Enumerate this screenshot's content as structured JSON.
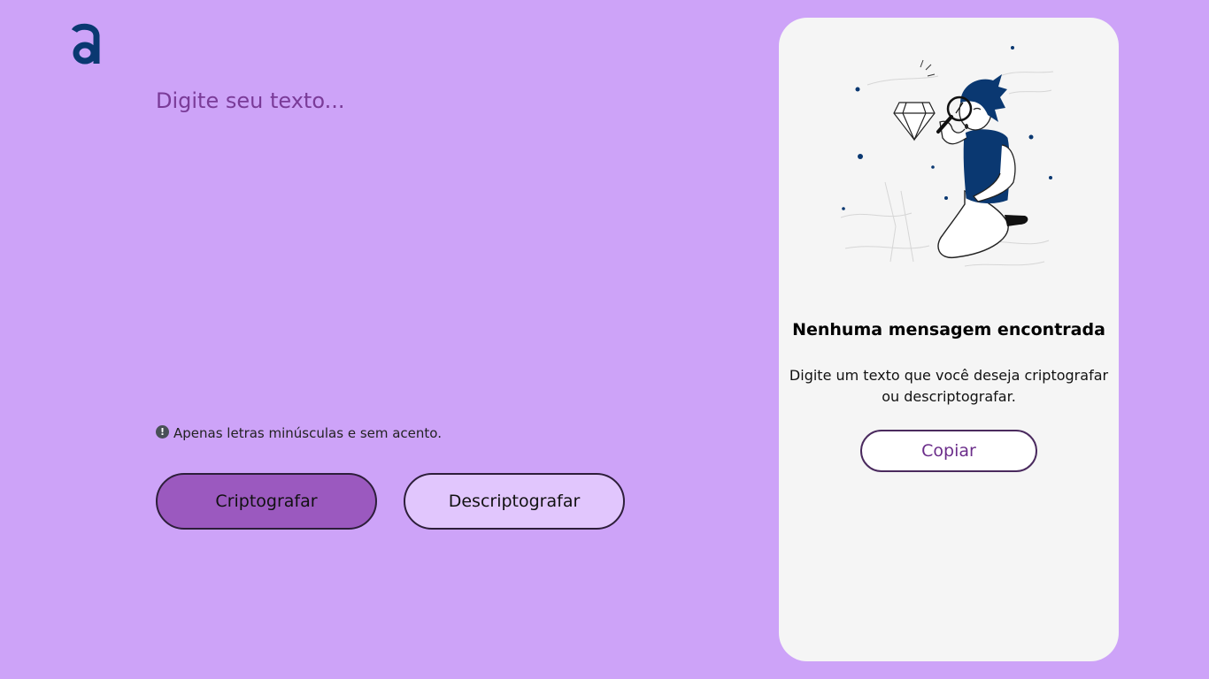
{
  "logo": {
    "icon": "alura-a-logo-icon",
    "color": "#0a3871"
  },
  "input": {
    "placeholder": "Digite seu texto..."
  },
  "hint": {
    "icon": "exclamation-circle-icon",
    "text": "Apenas letras minúsculas e sem acento."
  },
  "buttons": {
    "encrypt": "Criptografar",
    "decrypt": "Descriptografar"
  },
  "output": {
    "illustration": "person-magnifying-glass-diamond-illustration",
    "title": "Nenhuma mensagem encontrada",
    "description": "Digite um texto que você deseja criptografar ou descriptografar.",
    "copy_label": "Copiar"
  },
  "colors": {
    "background": "#cda3f8",
    "panel": "#f5f5f5",
    "encrypt_button": "#9b59bf",
    "decrypt_button": "#e1c6fd",
    "accent": "#0a3871"
  }
}
